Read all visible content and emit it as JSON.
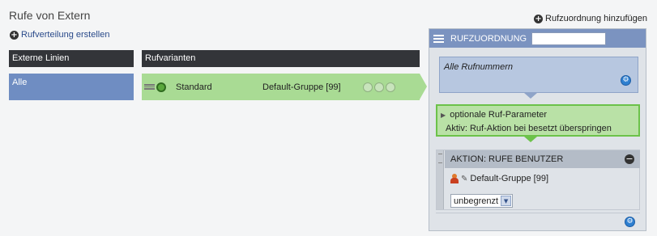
{
  "page": {
    "title": "Rufe von Extern",
    "add_distribution_label": "Rufverteilung erstellen",
    "add_assignment_label": "Rufzuordnung hinzufügen"
  },
  "columns": {
    "external_lines_header": "Externe Linien",
    "variants_header": "Rufvarianten"
  },
  "external_lines": [
    {
      "label": "Alle",
      "selected": true
    }
  ],
  "variants": [
    {
      "name": "Standard",
      "group": "Default-Gruppe [99]",
      "status_color": "#5aa83c"
    }
  ],
  "assignment_panel": {
    "title": "RUFZUORDNUNG",
    "name_value": "",
    "all_numbers_label": "Alle Rufnummern",
    "optional_params": {
      "title": "optionale Ruf-Parameter",
      "active_text": "Aktiv: Ruf-Aktion bei besetzt überspringen"
    },
    "action": {
      "title": "AKTION: RUFE BENUTZER",
      "group": "Default-Gruppe [99]",
      "limit_value": "unbegrenzt"
    }
  },
  "icons": {
    "add": "plus-circle-icon",
    "menu": "menu-lines-icon",
    "settings": "gear-icon",
    "remove": "minus-circle-icon",
    "user": "user-icon",
    "edit": "pencil-icon",
    "dropdown": "chevron-down-icon"
  },
  "colors": {
    "header_dark": "#333539",
    "selected_line": "#6f8dc2",
    "variant_green": "#a9db94",
    "panel_header": "#7b93c0",
    "accent_blue": "#2e7fd0",
    "optional_border": "#6cc24a"
  }
}
